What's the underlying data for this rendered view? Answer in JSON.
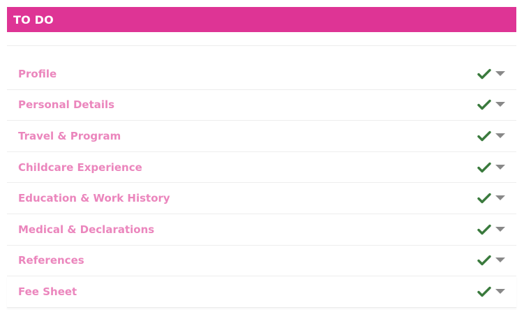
{
  "header": {
    "title": "TO DO"
  },
  "colors": {
    "header_bg": "#de3495",
    "label": "#eb86bd",
    "check": "#3a7a3d",
    "chevron": "#888888"
  },
  "items": [
    {
      "label": "Profile",
      "status_icon": "check-icon",
      "toggle_icon": "chevron-down-icon"
    },
    {
      "label": "Personal Details",
      "status_icon": "check-icon",
      "toggle_icon": "chevron-down-icon"
    },
    {
      "label": "Travel & Program",
      "status_icon": "check-icon",
      "toggle_icon": "chevron-down-icon"
    },
    {
      "label": "Childcare Experience",
      "status_icon": "check-icon",
      "toggle_icon": "chevron-down-icon"
    },
    {
      "label": "Education & Work History",
      "status_icon": "check-icon",
      "toggle_icon": "chevron-down-icon"
    },
    {
      "label": "Medical & Declarations",
      "status_icon": "check-icon",
      "toggle_icon": "chevron-down-icon"
    },
    {
      "label": "References",
      "status_icon": "check-icon",
      "toggle_icon": "chevron-down-icon"
    },
    {
      "label": "Fee Sheet",
      "status_icon": "check-icon",
      "toggle_icon": "chevron-down-icon"
    }
  ]
}
